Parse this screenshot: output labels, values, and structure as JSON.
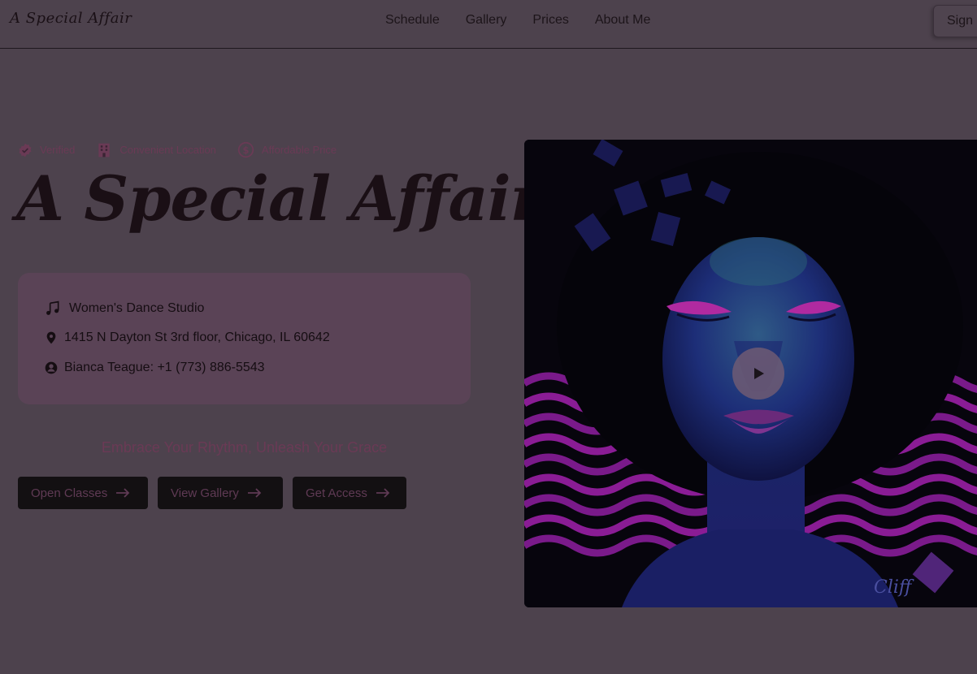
{
  "header": {
    "brand": "A Special Affair",
    "nav": [
      "Schedule",
      "Gallery",
      "Prices",
      "About Me"
    ],
    "sign_in": "Sign"
  },
  "badges": [
    {
      "icon": "verified-check-icon",
      "label": "Verified"
    },
    {
      "icon": "building-icon",
      "label": "Convenient Location"
    },
    {
      "icon": "dollar-circle-icon",
      "label": "Affordable Price"
    }
  ],
  "hero": {
    "title": "A Special Affair",
    "tagline": "Embrace Your Rhythm, Unleash Your Grace"
  },
  "info": {
    "studio": "Women's Dance Studio",
    "address": "1415 N Dayton St 3rd floor, Chicago, IL 60642",
    "contact": "Bianca Teague: +1 (773) 886-5543"
  },
  "buttons": [
    "Open Classes",
    "View Gallery",
    "Get Access"
  ],
  "colors": {
    "background": "#4d424d",
    "accent": "#6a3a55",
    "button_bg": "#131012",
    "card_bg": "#5a4356"
  },
  "media": {
    "artist_signature": "Cliff"
  }
}
